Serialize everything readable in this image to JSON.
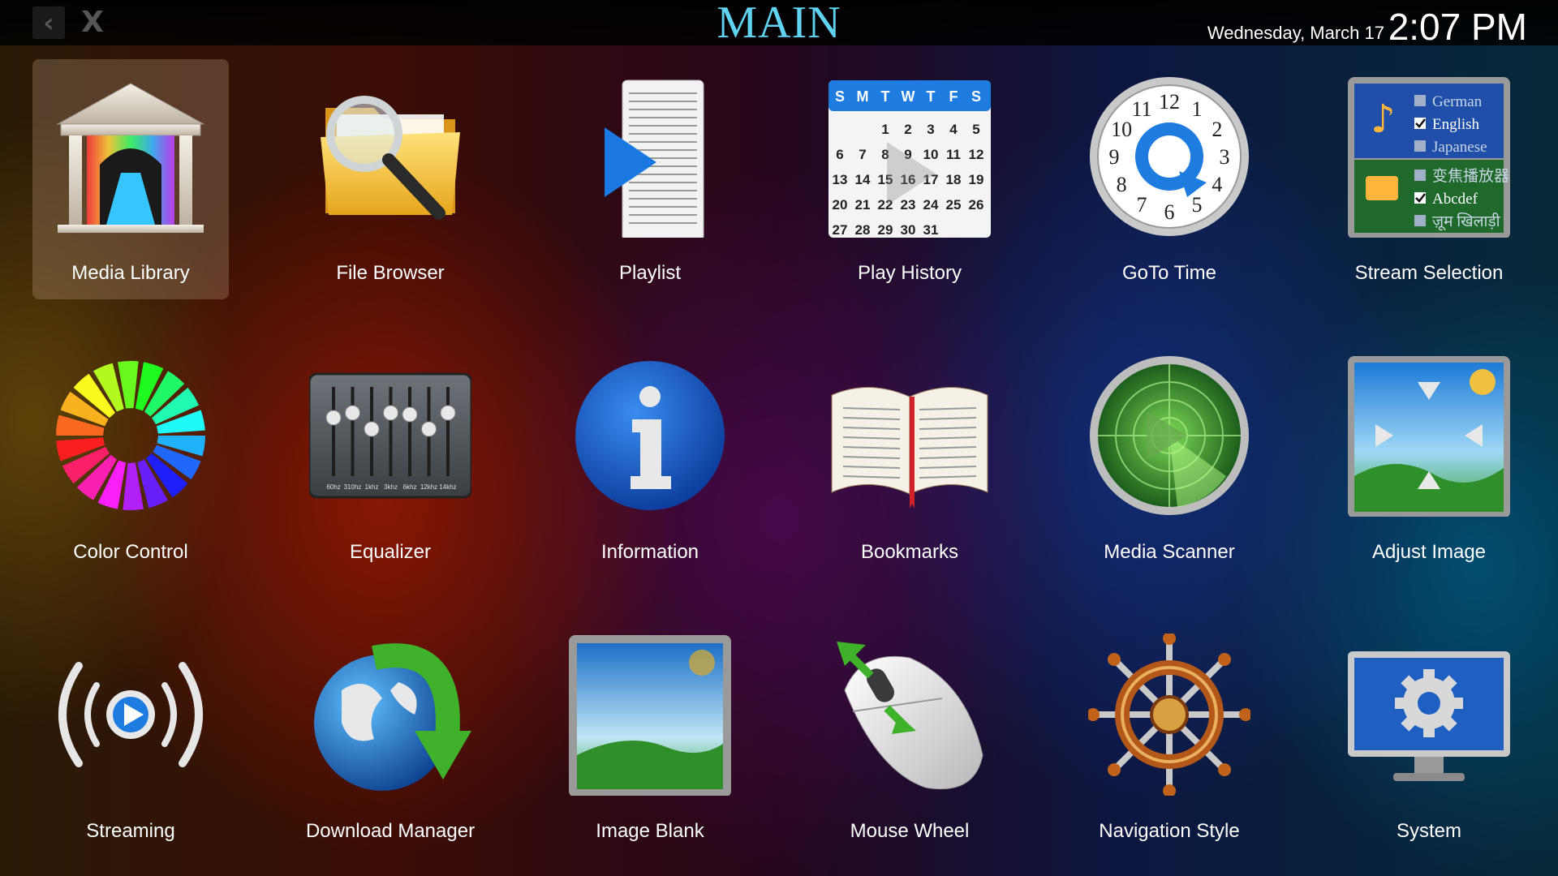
{
  "header": {
    "title": "MAIN",
    "back_label": "‹",
    "close_label": "X",
    "date": "Wednesday, March 17",
    "time": "2:07 PM"
  },
  "tiles": [
    {
      "label": "Media Library",
      "icon": "media-library-icon",
      "selected": true
    },
    {
      "label": "File Browser",
      "icon": "file-browser-icon"
    },
    {
      "label": "Playlist",
      "icon": "playlist-icon"
    },
    {
      "label": "Play History",
      "icon": "play-history-icon"
    },
    {
      "label": "GoTo Time",
      "icon": "goto-time-icon"
    },
    {
      "label": "Stream Selection",
      "icon": "stream-selection-icon"
    },
    {
      "label": "Color Control",
      "icon": "color-control-icon"
    },
    {
      "label": "Equalizer",
      "icon": "equalizer-icon"
    },
    {
      "label": "Information",
      "icon": "information-icon"
    },
    {
      "label": "Bookmarks",
      "icon": "bookmarks-icon"
    },
    {
      "label": "Media Scanner",
      "icon": "media-scanner-icon"
    },
    {
      "label": "Adjust Image",
      "icon": "adjust-image-icon"
    },
    {
      "label": "Streaming",
      "icon": "streaming-icon"
    },
    {
      "label": "Download Manager",
      "icon": "download-manager-icon"
    },
    {
      "label": "Image Blank",
      "icon": "image-blank-icon"
    },
    {
      "label": "Mouse Wheel",
      "icon": "mouse-wheel-icon"
    },
    {
      "label": "Navigation Style",
      "icon": "navigation-style-icon"
    },
    {
      "label": "System",
      "icon": "system-icon"
    }
  ],
  "calendar": {
    "weekdays": [
      "S",
      "M",
      "T",
      "W",
      "T",
      "F",
      "S"
    ],
    "rows": [
      [
        "",
        "",
        "1",
        "2",
        "3",
        "4",
        "5"
      ],
      [
        "6",
        "7",
        "8",
        "9",
        "10",
        "11",
        "12"
      ],
      [
        "13",
        "14",
        "15",
        "16",
        "17",
        "18",
        "19"
      ],
      [
        "20",
        "21",
        "22",
        "23",
        "24",
        "25",
        "26"
      ],
      [
        "27",
        "28",
        "29",
        "30",
        "31",
        "",
        ""
      ]
    ]
  },
  "clock_numbers": [
    "12",
    "1",
    "2",
    "3",
    "4",
    "5",
    "6",
    "7",
    "8",
    "9",
    "10",
    "11"
  ],
  "stream_selection": {
    "audio": [
      {
        "label": "German",
        "checked": false
      },
      {
        "label": "English",
        "checked": true
      },
      {
        "label": "Japanese",
        "checked": false
      }
    ],
    "subtitles": [
      {
        "label": "变焦播放器",
        "checked": false
      },
      {
        "label": "Abcdef",
        "checked": true
      },
      {
        "label": "ज़ूम खिलाड़ी",
        "checked": false
      }
    ]
  },
  "equalizer_bands": [
    "60hz",
    "310hz",
    "1khz",
    "3khz",
    "6khz",
    "12khz",
    "14khz"
  ]
}
